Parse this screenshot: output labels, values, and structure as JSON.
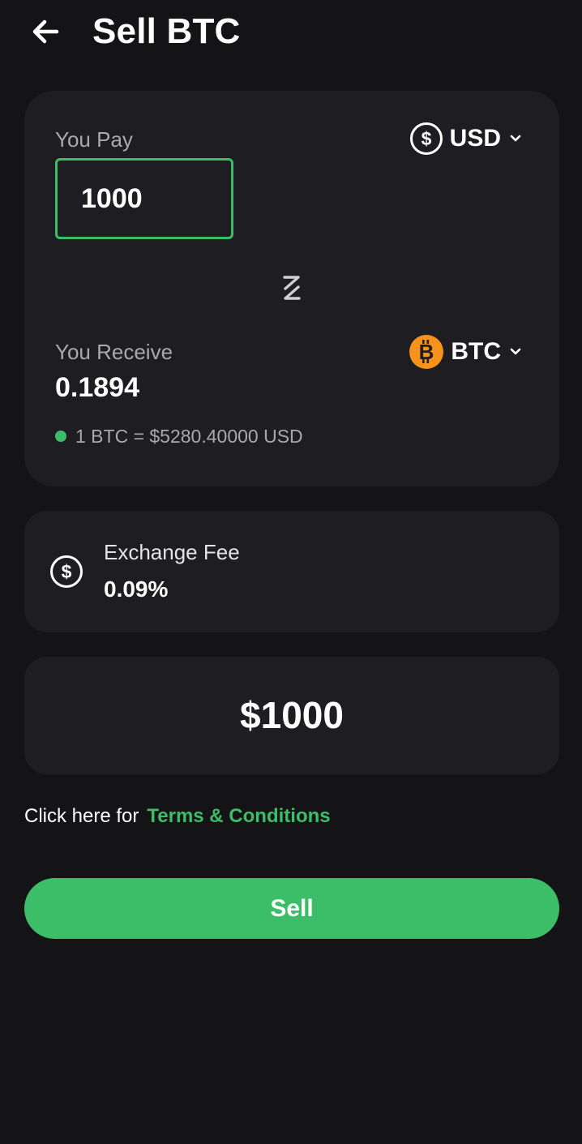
{
  "header": {
    "title": "Sell BTC",
    "back_icon": "arrow-left-icon"
  },
  "exchange": {
    "pay_label": "You Pay",
    "pay_amount": "1000",
    "pay_currency": "USD",
    "pay_currency_icon": "dollar-circle-icon",
    "swap_icon": "swap-icon",
    "receive_label": "You Receive",
    "receive_amount": "0.1894",
    "receive_currency": "BTC",
    "receive_currency_icon": "bitcoin-icon",
    "rate_text": "1 BTC = $5280.40000 USD"
  },
  "fee": {
    "label": "Exchange Fee",
    "value": "0.09%",
    "icon": "dollar-circle-icon"
  },
  "total": {
    "amount": "$1000"
  },
  "terms": {
    "prefix": "Click here for",
    "link": "Terms & Conditions"
  },
  "action": {
    "sell_label": "Sell"
  },
  "colors": {
    "background": "#141416",
    "card": "#1e1e22",
    "accent_green": "#3cbe68",
    "bitcoin_orange": "#f7931a",
    "muted_text": "#a8a8ad"
  }
}
